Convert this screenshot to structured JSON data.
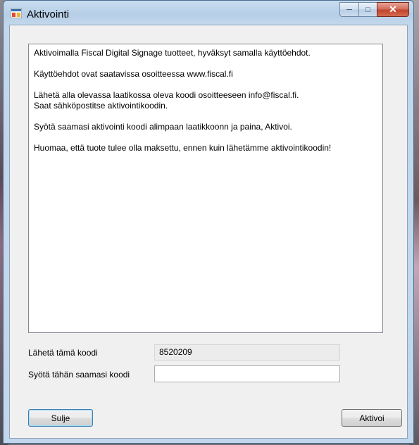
{
  "window": {
    "title": "Aktivointi"
  },
  "content": {
    "paragraphs": [
      "Aktivoimalla Fiscal Digital Signage tuotteet, hyväksyt samalla käyttöehdot.",
      "Käyttöehdot ovat saatavissa osoitteessa www.fiscal.fi",
      "Lähetä alla olevassa laatikossa oleva koodi osoitteeseen info@fiscal.fi.\nSaat sähköpostitse aktivointikoodin.",
      "Syötä saamasi aktivointi koodi alimpaan laatikkoonn ja paina, Aktivoi.",
      "Huomaa, että tuote tulee olla maksettu, ennen kuin lähetämme aktivointikoodin!"
    ]
  },
  "form": {
    "send_code_label": "Lähetä tämä koodi",
    "send_code_value": "8520209",
    "enter_code_label": "Syötä tähän saamasi koodi",
    "enter_code_value": ""
  },
  "buttons": {
    "close_label": "Sulje",
    "activate_label": "Aktivoi"
  },
  "colors": {
    "title_bar": "#c3d7ec",
    "client_bg": "#f0f0f0",
    "close_caption": "#c0452f"
  },
  "icons": {
    "title": "app-window-icon",
    "minimize": "minimize-icon",
    "maximize": "maximize-icon",
    "close": "close-icon"
  }
}
